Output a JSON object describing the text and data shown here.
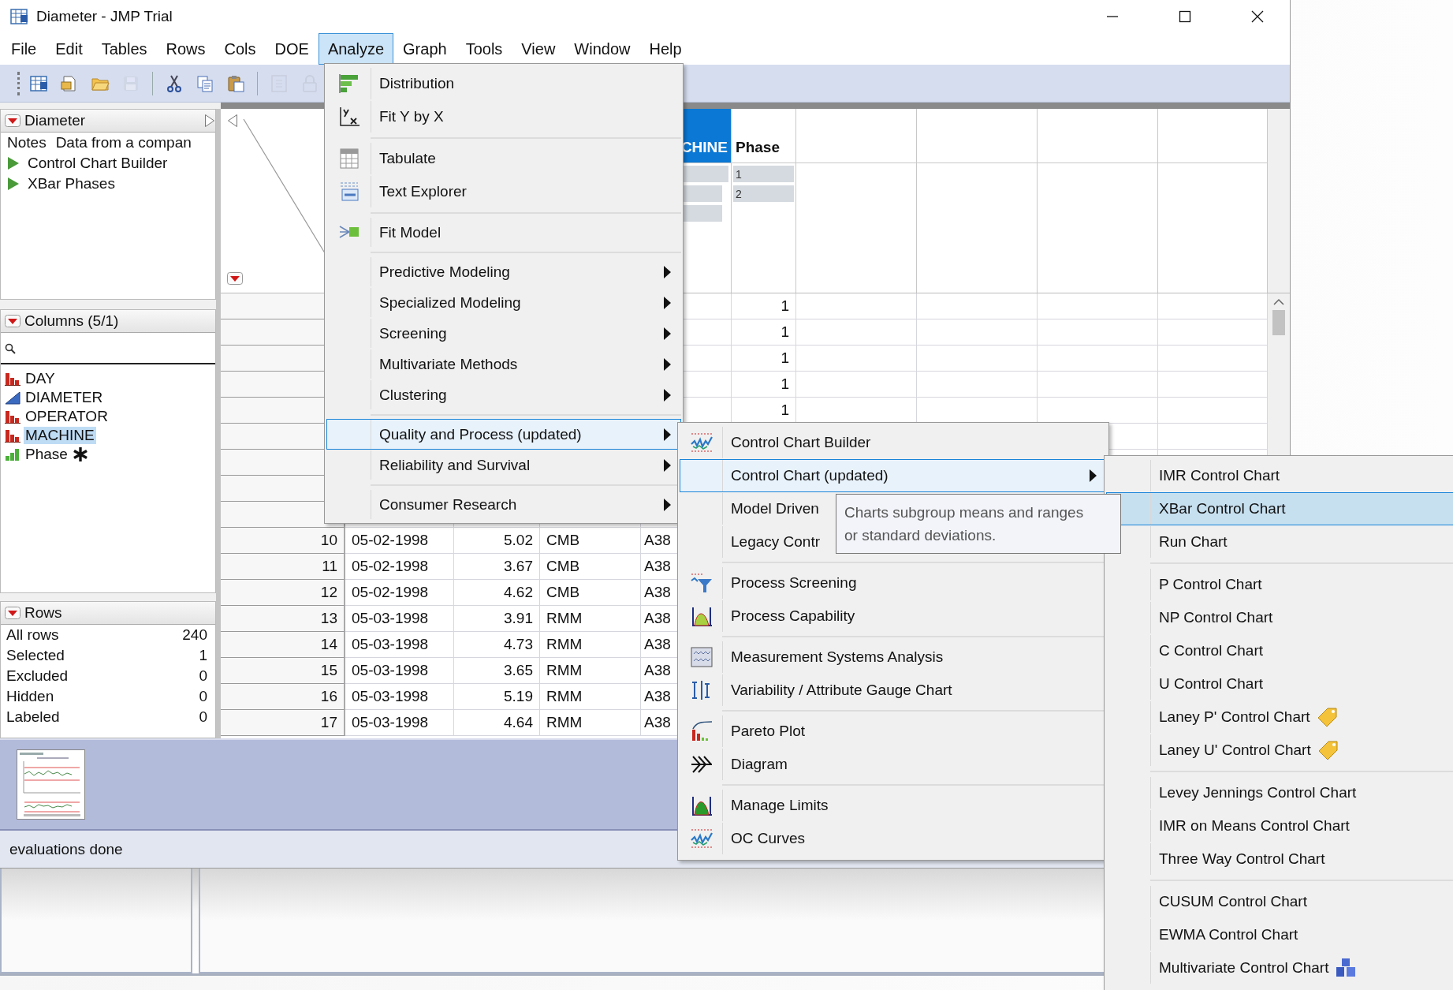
{
  "window": {
    "title": "Diameter - JMP Trial"
  },
  "menu_bar": [
    {
      "label": "File",
      "selected": false
    },
    {
      "label": "Edit",
      "selected": false
    },
    {
      "label": "Tables",
      "selected": false
    },
    {
      "label": "Rows",
      "selected": false
    },
    {
      "label": "Cols",
      "selected": false
    },
    {
      "label": "DOE",
      "selected": false
    },
    {
      "label": "Analyze",
      "selected": true
    },
    {
      "label": "Graph",
      "selected": false
    },
    {
      "label": "Tools",
      "selected": false
    },
    {
      "label": "View",
      "selected": false
    },
    {
      "label": "Window",
      "selected": false
    },
    {
      "label": "Help",
      "selected": false
    }
  ],
  "toolbar": [
    {
      "disabled": false
    },
    {
      "disabled": false
    },
    {
      "disabled": false
    },
    {
      "disabled": true
    },
    {
      "disabled": false
    },
    {
      "disabled": false
    },
    {
      "disabled": false
    },
    {
      "disabled": true
    },
    {
      "disabled": true
    }
  ],
  "table_panel": {
    "title": "Diameter",
    "notes_label": "Notes",
    "notes_value": "Data from a compan",
    "scripts": [
      "Control Chart Builder",
      "XBar Phases"
    ]
  },
  "columns_panel": {
    "title": "Columns (5/1)",
    "columns": [
      {
        "name": "DAY",
        "kind": "nominal",
        "selected": false,
        "has_properties": false
      },
      {
        "name": "DIAMETER",
        "kind": "continuous",
        "selected": false,
        "has_properties": false
      },
      {
        "name": "OPERATOR",
        "kind": "nominal",
        "selected": false,
        "has_properties": false
      },
      {
        "name": "MACHINE",
        "kind": "nominal",
        "selected": true,
        "has_properties": false
      },
      {
        "name": "Phase",
        "kind": "ordinal",
        "selected": false,
        "has_properties": true
      }
    ]
  },
  "rows_panel": {
    "title": "Rows",
    "stats": [
      {
        "label": "All rows",
        "value": "240"
      },
      {
        "label": "Selected",
        "value": "1"
      },
      {
        "label": "Excluded",
        "value": "0"
      },
      {
        "label": "Hidden",
        "value": "0"
      },
      {
        "label": "Labeled",
        "value": "0"
      }
    ]
  },
  "data_table": {
    "column_headers": [
      {
        "label": "CHINE",
        "selected": true
      },
      {
        "label": "Phase",
        "selected": false
      }
    ],
    "phase_summary": [
      "1",
      "2"
    ],
    "phase_values": [
      "1",
      "1",
      "1",
      "1",
      "1"
    ],
    "rows": [
      {
        "row": "10",
        "day": "05-02-1998",
        "diameter": "5.02",
        "operator": "CMB",
        "machine": "A38"
      },
      {
        "row": "11",
        "day": "05-02-1998",
        "diameter": "3.67",
        "operator": "CMB",
        "machine": "A38"
      },
      {
        "row": "12",
        "day": "05-02-1998",
        "diameter": "4.62",
        "operator": "CMB",
        "machine": "A38"
      },
      {
        "row": "13",
        "day": "05-03-1998",
        "diameter": "3.91",
        "operator": "RMM",
        "machine": "A38"
      },
      {
        "row": "14",
        "day": "05-03-1998",
        "diameter": "4.73",
        "operator": "RMM",
        "machine": "A38"
      },
      {
        "row": "15",
        "day": "05-03-1998",
        "diameter": "3.65",
        "operator": "RMM",
        "machine": "A38"
      },
      {
        "row": "16",
        "day": "05-03-1998",
        "diameter": "5.19",
        "operator": "RMM",
        "machine": "A38"
      },
      {
        "row": "17",
        "day": "05-03-1998",
        "diameter": "4.64",
        "operator": "RMM",
        "machine": "A38"
      }
    ]
  },
  "status_bar": "evaluations done",
  "analyze_menu": {
    "groups": [
      [
        {
          "label": "Distribution",
          "submenu": false,
          "selected": false
        },
        {
          "label": "Fit Y by X",
          "selected": false
        }
      ],
      [
        {
          "label": "Tabulate",
          "submenu": false,
          "selected": false
        },
        {
          "label": "Text Explorer",
          "submenu": false,
          "selected": false
        }
      ],
      [
        {
          "label": "Fit Model",
          "submenu": false,
          "selected": false
        }
      ],
      [
        {
          "label": "Predictive Modeling",
          "submenu": true,
          "selected": false
        },
        {
          "label": "Specialized Modeling",
          "submenu": true,
          "selected": false
        },
        {
          "label": "Screening",
          "submenu": true,
          "selected": false
        },
        {
          "label": "Multivariate Methods",
          "submenu": true,
          "selected": false
        },
        {
          "label": "Clustering",
          "submenu": true,
          "selected": false
        }
      ],
      [
        {
          "label": "Quality and Process (updated)",
          "submenu": true,
          "selected": true
        },
        {
          "label": "Reliability and Survival",
          "submenu": true,
          "selected": false
        }
      ],
      [
        {
          "label": "Consumer Research",
          "submenu": true,
          "selected": false
        }
      ]
    ]
  },
  "quality_menu": {
    "groups": [
      [
        {
          "label": "Control Chart Builder",
          "submenu": false,
          "selected": false
        },
        {
          "label": "Control Chart (updated)",
          "submenu": true,
          "selected": true
        },
        {
          "label": "Model Driven",
          "selected": false
        },
        {
          "label": "Legacy Contr",
          "selected": false
        }
      ],
      [
        {
          "label": "Process Screening",
          "submenu": false,
          "selected": false
        },
        {
          "label": "Process Capability",
          "submenu": false,
          "selected": false
        }
      ],
      [
        {
          "label": "Measurement Systems Analysis",
          "submenu": false,
          "selected": false
        },
        {
          "label": "Variability / Attribute Gauge Chart",
          "submenu": false,
          "selected": false
        }
      ],
      [
        {
          "label": "Pareto Plot",
          "submenu": false,
          "selected": false
        },
        {
          "label": "Diagram",
          "submenu": false,
          "selected": false
        }
      ],
      [
        {
          "label": "Manage Limits",
          "submenu": false,
          "selected": false
        },
        {
          "label": "OC Curves",
          "submenu": false,
          "selected": false
        }
      ]
    ]
  },
  "control_chart_menu": {
    "groups": [
      [
        {
          "label": "IMR Control Chart",
          "submenu": false,
          "selected": false
        },
        {
          "label": "XBar Control Chart",
          "submenu": false,
          "selected": true
        },
        {
          "label": "Run Chart",
          "submenu": false,
          "selected": false
        }
      ],
      [
        {
          "label": "P Control Chart",
          "submenu": false,
          "selected": false
        },
        {
          "label": "NP Control Chart",
          "submenu": false,
          "selected": false
        },
        {
          "label": "C Control Chart",
          "submenu": false,
          "selected": false
        },
        {
          "label": "U Control Chart",
          "submenu": false,
          "selected": false
        },
        {
          "label": "Laney P' Control Chart",
          "submenu": false,
          "selected": false
        },
        {
          "label": "Laney U' Control Chart",
          "submenu": false,
          "selected": false
        }
      ],
      [
        {
          "label": "Levey Jennings Control Chart",
          "submenu": false,
          "selected": false
        },
        {
          "label": "IMR on Means Control Chart",
          "submenu": false,
          "selected": false
        },
        {
          "label": "Three Way Control Chart",
          "submenu": false,
          "selected": false
        }
      ],
      [
        {
          "label": "CUSUM Control Chart",
          "submenu": false,
          "selected": false
        },
        {
          "label": "EWMA Control Chart",
          "submenu": false,
          "selected": false
        },
        {
          "label": "Multivariate Control Chart",
          "submenu": false,
          "selected": false
        }
      ]
    ]
  },
  "tooltip": {
    "text": "Charts subgroup means and ranges\nor standard deviations."
  }
}
